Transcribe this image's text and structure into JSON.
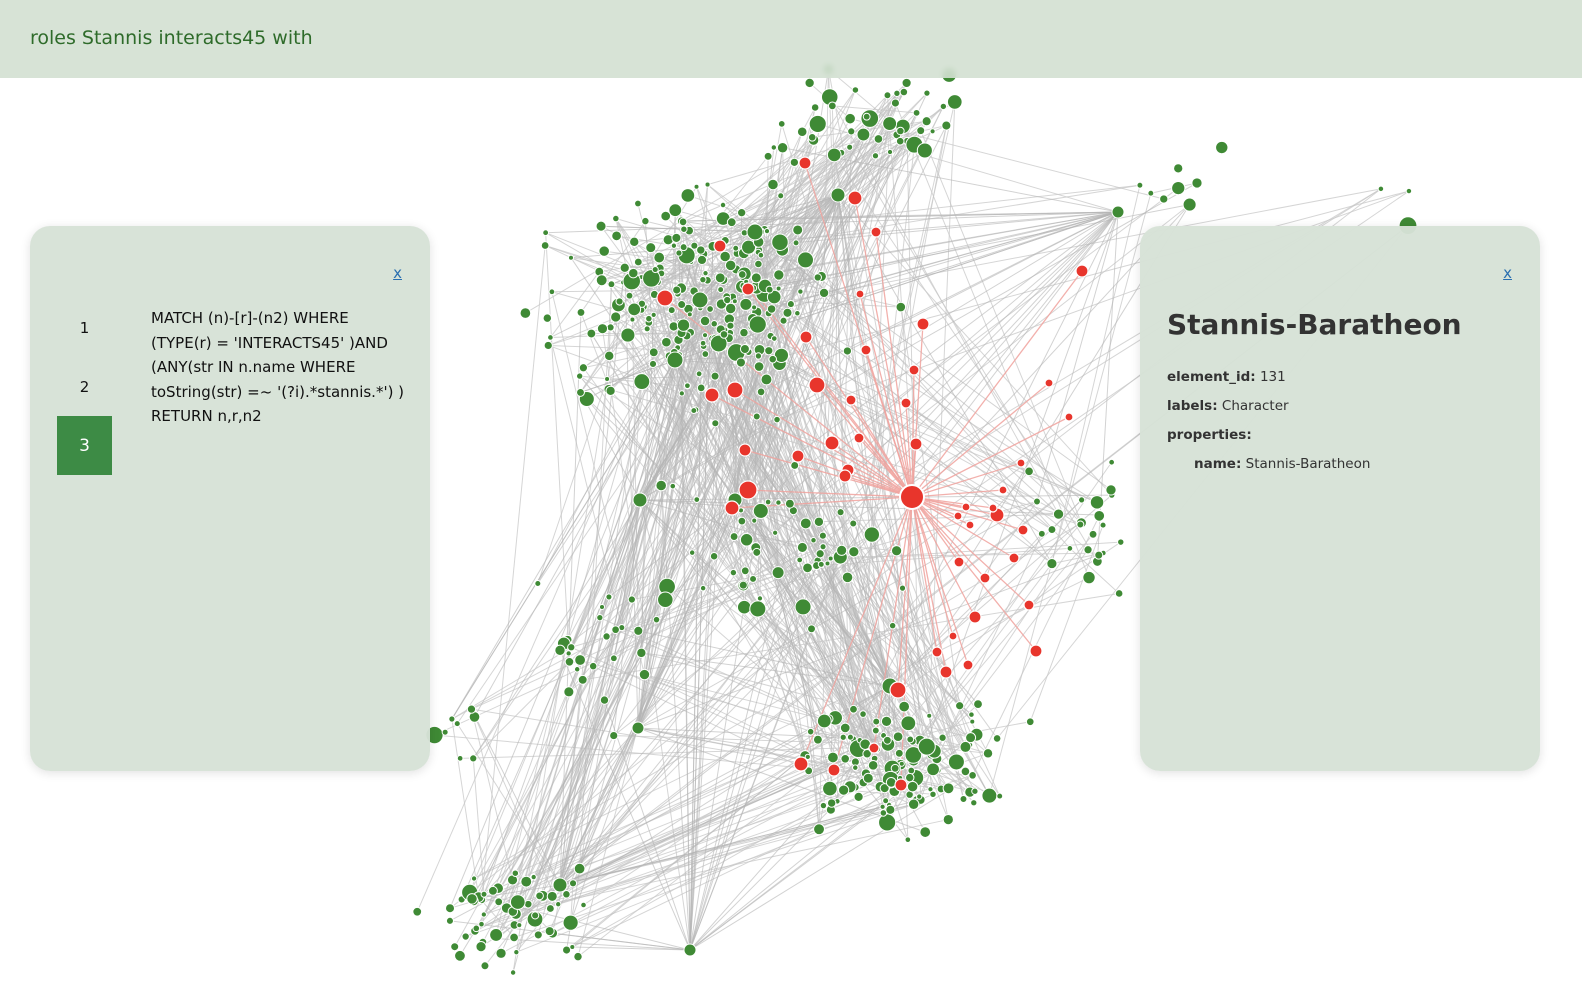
{
  "header": {
    "title": "roles Stannis interacts45 with"
  },
  "query_panel": {
    "close_label": "x",
    "steps": [
      "1",
      "2",
      "3"
    ],
    "active_step": "3",
    "query": "MATCH (n)-[r]-(n2) WHERE (TYPE(r) = 'INTERACTS45' )AND (ANY(str IN n.name WHERE toString(str) =~ '(?i).*stannis.*') ) RETURN n,r,n2"
  },
  "detail_panel": {
    "close_label": "x",
    "title": "Stannis-Baratheon",
    "element_id_key": "element_id:",
    "element_id_value": "131",
    "labels_key": "labels:",
    "labels_value": "Character",
    "properties_key": "properties:",
    "name_key": "name:",
    "name_value": "Stannis-Baratheon"
  },
  "graph": {
    "highlight_color": "#e8352c",
    "node_color": "#3f8a35",
    "edge_color": "#c8c8c8",
    "highlight_edge_color": "#f0a39e"
  }
}
